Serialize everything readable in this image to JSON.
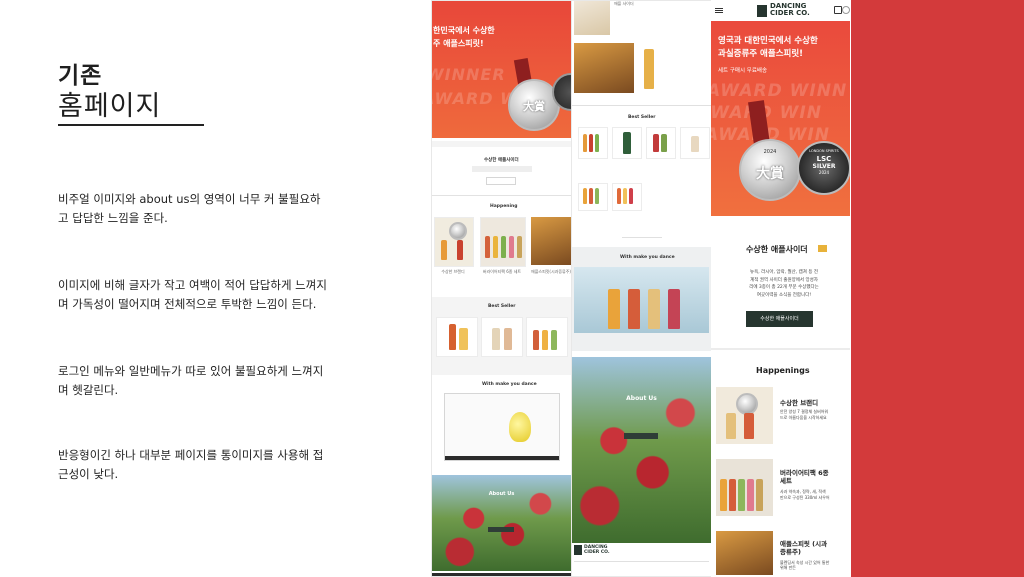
{
  "left": {
    "title_line1": "기존",
    "title_line2": "홈페이지",
    "notes": [
      "비주얼 이미지와 about us의 영역이 너무 커 불필요하고 답답한 느낌을 준다.",
      "이미지에 비해 글자가 작고 여백이 적어 답답하게 느껴지며 가독성이 떨어지며 전체적으로 투박한 느낌이 든다.",
      "로그인 메뉴와 일반메뉴가 따로 있어 불필요하게 느껴지며 헷갈린다.",
      "반응형이긴 하나 대부분 페이지를 통이미지를 사용해 접근성이 낮다."
    ]
  },
  "desktop_left": {
    "hero_line1": "한민국에서 수상한",
    "hero_line2": "주 애플스피릿!",
    "watermark1": "WINNER",
    "watermark2": "AWARD WINNER",
    "medal_label": "大賞",
    "section_award": "수상한 애플사이더",
    "section_happening": "Happening",
    "happening_items": [
      "수상한 브랜디",
      "버라이어티팩 6종 세트",
      "애플스피릿(시과증류주)"
    ],
    "section_best": "Best Seller",
    "section_with": "With make you dance",
    "section_about": "About Us"
  },
  "desktop_mid": {
    "top_label": "애플 사이더",
    "section_best": "Best Seller",
    "section_with": "With make you dance",
    "section_about": "About Us",
    "footer_logo_line1": "DANCING",
    "footer_logo_line2": "CIDER CO."
  },
  "mobile": {
    "logo_line1": "DANCING",
    "logo_line2": "CIDER CO.",
    "hero_line1": "영국과 대한민국에서 수상한",
    "hero_line2": "과실증류주 애플스피릿!",
    "hero_sub": "세트 구매시 무료배송",
    "medal_label": "大賞",
    "medal_year": "2024",
    "badge_line1": "LONDON SPIRITS",
    "badge_line2": "LSC",
    "badge_line3": "SILVER",
    "badge_line4": "2024",
    "section_award": "수상한 애플사이더",
    "award_text": "뉴욕, 라시아, 암락, 월산, 캡쳐 등 전계적 권역 사이더 출원양에서 앙성자리에 3종이 총 22개 부문 수상했다는 여곳이력을 소식을 전합니다!",
    "award_button": "수상한 애플사이더",
    "section_happenings": "Happenings",
    "items": [
      {
        "title": "수상한 브랜디",
        "desc": "안전 양성 7 결정체 실버어워드로 아름다움을 시작하세요"
      },
      {
        "title": "버라이어티팩 6종 세트",
        "desc": "사과 약속과, 정략, 새, 적색 만으로 구성된 330ml 샤우어"
      },
      {
        "title": "애플스피릿 (시과증류주)",
        "desc": "블렌딩서 숙성 시간 있어 통한 위해 만든"
      }
    ]
  },
  "colors": {
    "accent_red": "#d33a3b",
    "hero_red": "#e8473a",
    "dark_green": "#26352f"
  }
}
